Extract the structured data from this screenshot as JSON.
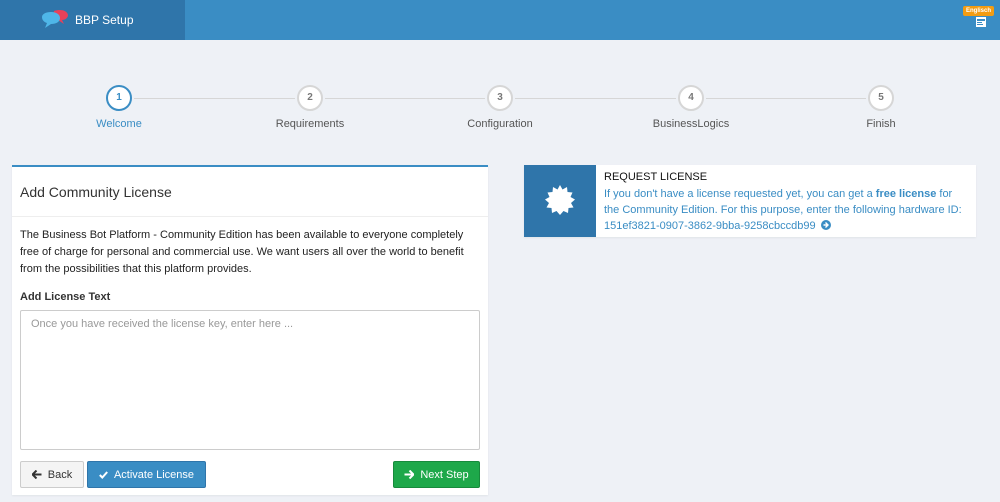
{
  "app": {
    "title": "BBP Setup"
  },
  "language": {
    "badge": "Englisch"
  },
  "steps": [
    {
      "number": "1",
      "label": "Welcome"
    },
    {
      "number": "2",
      "label": "Requirements"
    },
    {
      "number": "3",
      "label": "Configuration"
    },
    {
      "number": "4",
      "label": "BusinessLogics"
    },
    {
      "number": "5",
      "label": "Finish"
    }
  ],
  "active_step": 1,
  "license_card": {
    "title": "Add Community License",
    "description": "The Business Bot Platform - Community Edition has been available to everyone completely free of charge for personal and commercial use. We want users all over the world to benefit from the possibilities that this platform provides.",
    "field_label": "Add License Text",
    "placeholder": "Once you have received the license key, enter here ...",
    "value": "",
    "back_label": "Back",
    "activate_label": "Activate License",
    "next_label": "Next Step"
  },
  "request_license": {
    "title": "REQUEST LICENSE",
    "text_before": "If you don't have a license requested yet, you can get a ",
    "link_text": "free license",
    "text_after": " for the Community Edition. For this purpose, enter the following hardware ID: 151ef3821-0907-3862-9bba-9258cbccdb99"
  },
  "colors": {
    "primary": "#3a8dc4",
    "header_dark": "#2f75aa",
    "success": "#1ea84a",
    "background": "#eef1f6"
  },
  "icons": {
    "logo": "chat-bubbles-icon",
    "language": "flag-icon",
    "back": "arrow-left-icon",
    "activate": "checkmark-icon",
    "next": "arrow-right-icon",
    "request": "certificate-icon",
    "go": "circle-arrow-right-icon"
  }
}
